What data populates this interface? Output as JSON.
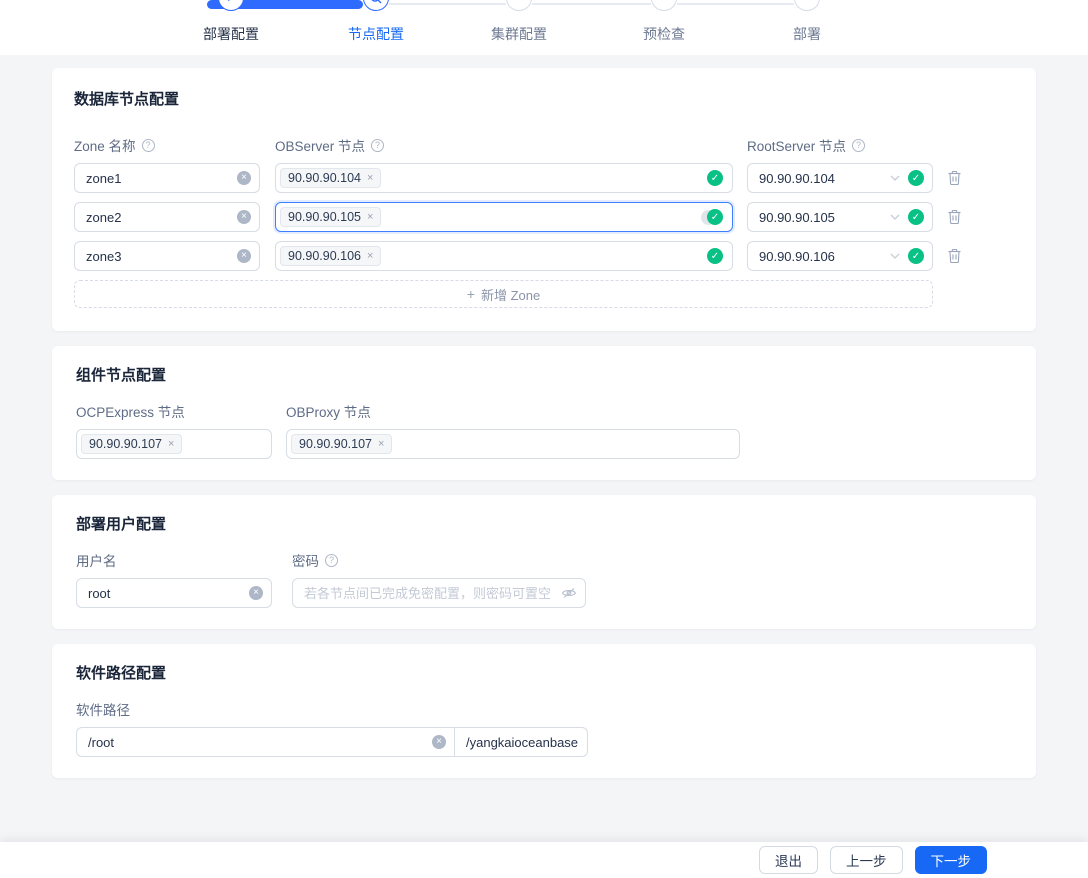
{
  "colors": {
    "primary": "#1668f5",
    "success_green": "#0ac185",
    "step_bar_blue": "#2f6bff",
    "page_bg": "#f4f5f7"
  },
  "stepper": {
    "steps": [
      {
        "label": "部署配置",
        "status": "done"
      },
      {
        "label": "节点配置",
        "status": "active"
      },
      {
        "label": "集群配置",
        "status": "pending"
      },
      {
        "label": "预检查",
        "status": "pending"
      },
      {
        "label": "部署",
        "status": "pending"
      }
    ],
    "done_glyph": "✓"
  },
  "db_card": {
    "title": "数据库节点配置",
    "zone_label": "Zone 名称",
    "observer_label": "OBServer 节点",
    "rootserver_label": "RootServer 节点",
    "rows": [
      {
        "zone": "zone1",
        "observer_tag": "90.90.90.104",
        "rootserver": "90.90.90.104"
      },
      {
        "zone": "zone2",
        "observer_tag": "90.90.90.105",
        "rootserver": "90.90.90.105"
      },
      {
        "zone": "zone3",
        "observer_tag": "90.90.90.106",
        "rootserver": "90.90.90.106"
      }
    ],
    "add_zone_label": "新增 Zone",
    "plus_glyph": "+"
  },
  "component_card": {
    "title": "组件节点配置",
    "ocp_label": "OCPExpress 节点",
    "obproxy_label": "OBProxy 节点",
    "ocp_tag": "90.90.90.107",
    "obproxy_tag": "90.90.90.107"
  },
  "user_card": {
    "title": "部署用户配置",
    "username_label": "用户名",
    "username_value": "root",
    "password_label": "密码",
    "password_placeholder": "若各节点间已完成免密配置，则密码可置空"
  },
  "path_card": {
    "title": "软件路径配置",
    "path_label": "软件路径",
    "path_value": "/root",
    "path_suffix": "/yangkaioceanbase"
  },
  "footer": {
    "exit_label": "退出",
    "prev_label": "上一步",
    "next_label": "下一步"
  },
  "glyphs": {
    "check": "✓",
    "close": "×",
    "question": "?"
  }
}
